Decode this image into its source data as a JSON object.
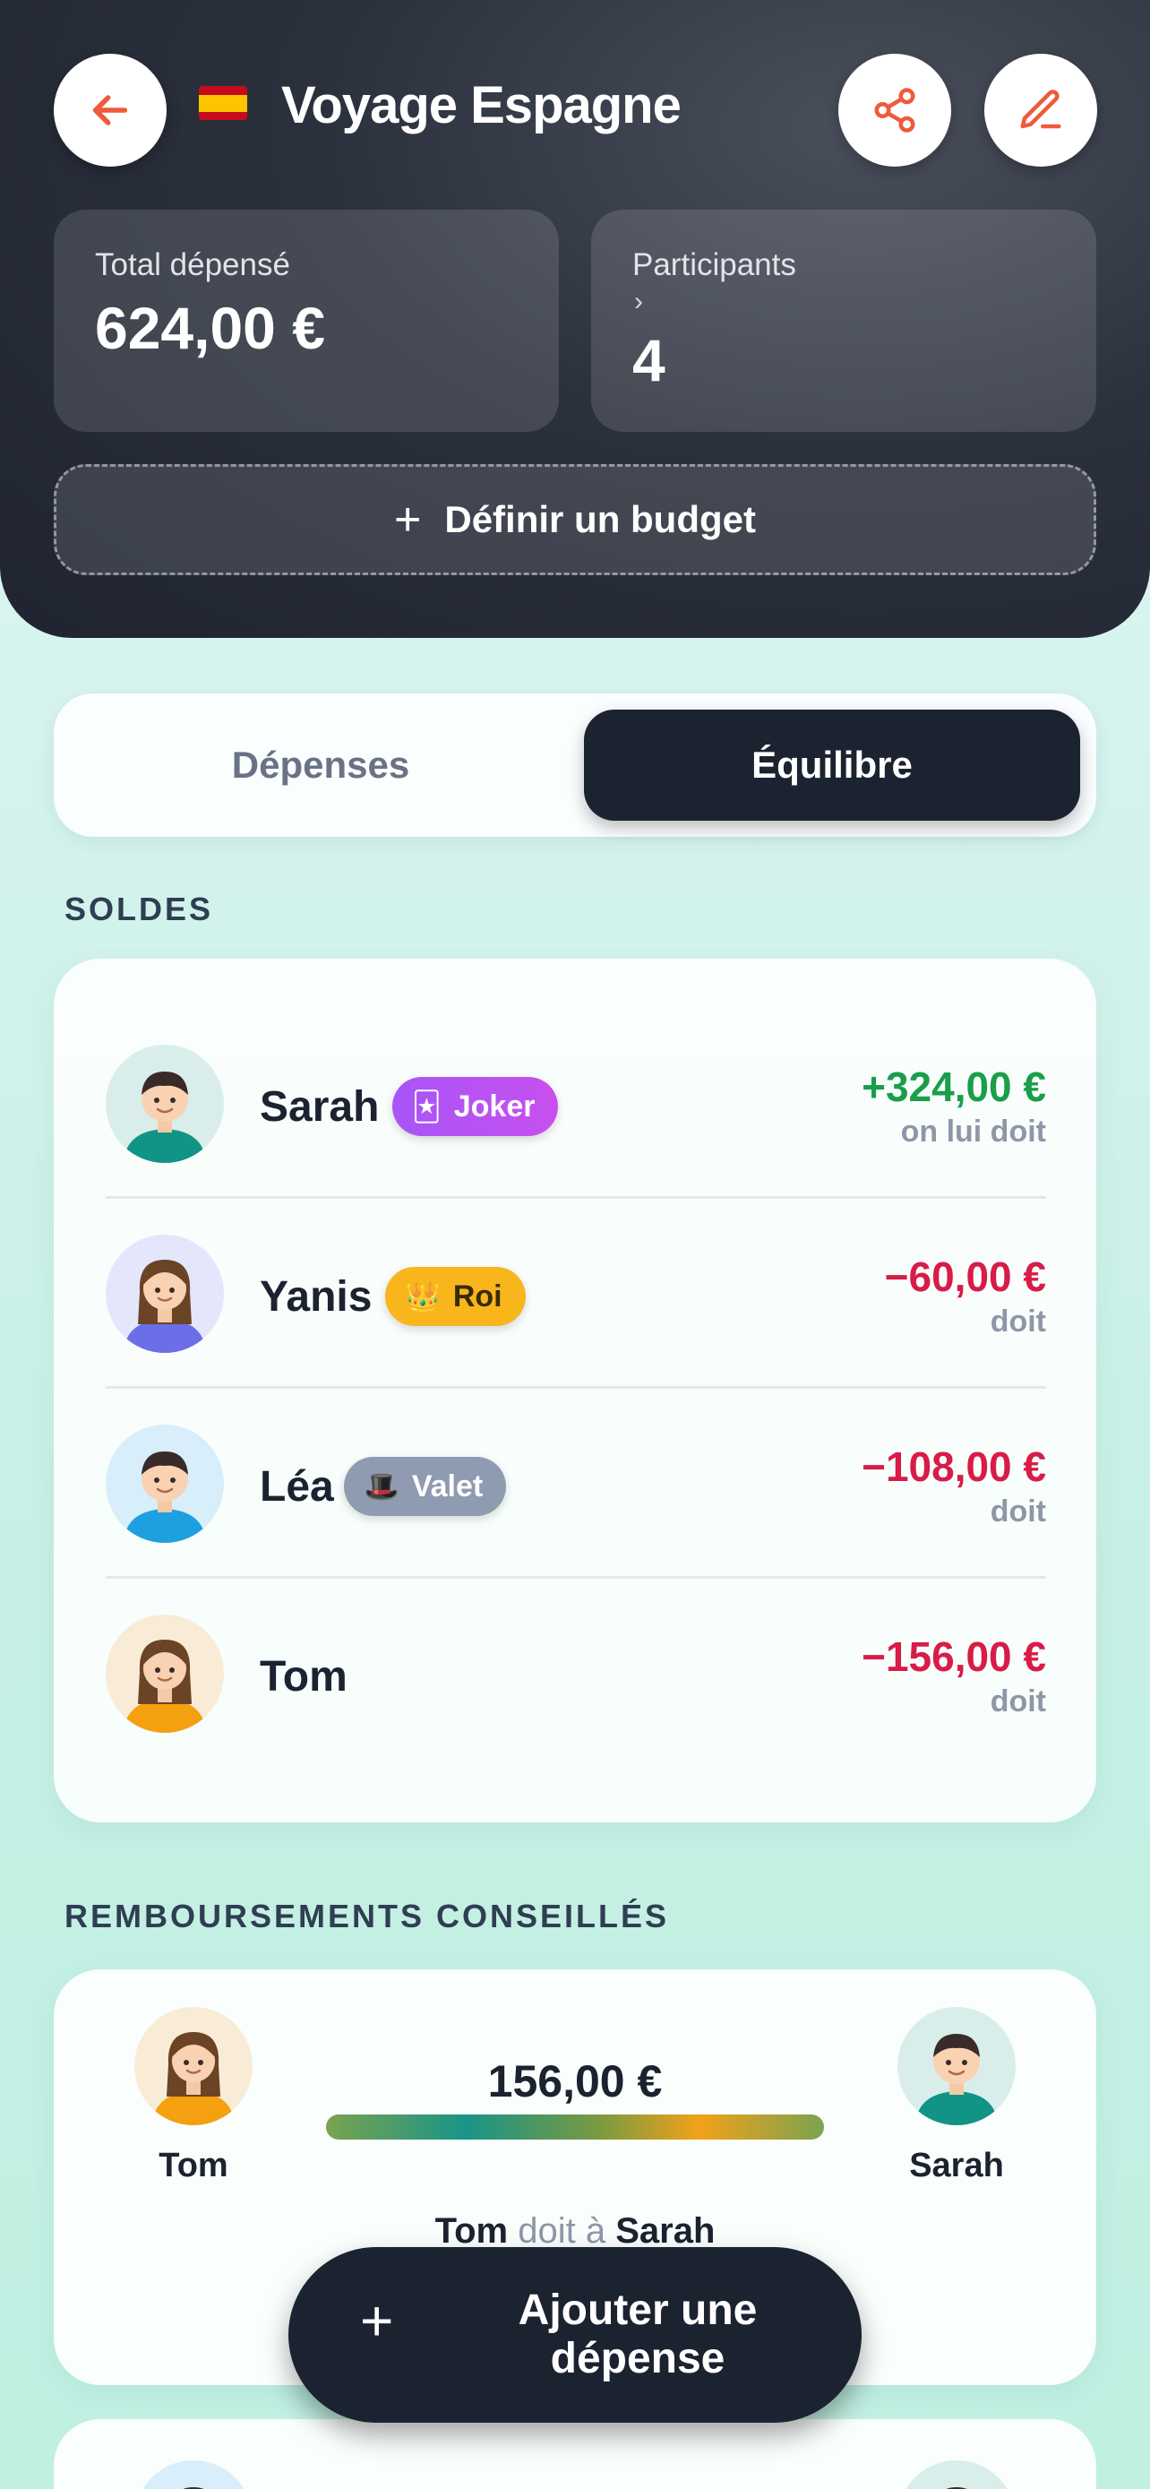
{
  "header": {
    "title": "Voyage Espagne",
    "flag": "spain-flag",
    "total_label": "Total dépensé",
    "total_value": "624,00 €",
    "participants_label": "Participants",
    "participants_chevron": "›",
    "participants_value": "4",
    "budget_label": "Définir un budget",
    "budget_plus": "+"
  },
  "icons": {
    "back": "arrow-left-icon",
    "share": "share-icon",
    "edit": "pencil-icon",
    "accent": "#ef5a3c"
  },
  "tabs": {
    "expenses": "Dépenses",
    "balance": "Équilibre",
    "active": "balance"
  },
  "balances": {
    "section_title": "SOLDES",
    "rows": [
      {
        "name": "Sarah",
        "badge": "Joker",
        "badge_icon": "🃏",
        "amount": "+324,00 €",
        "status": "on lui doit",
        "sign": "pos"
      },
      {
        "name": "Yanis",
        "badge": "Roi",
        "badge_icon": "👑",
        "amount": "−60,00 €",
        "status": "doit",
        "sign": "neg"
      },
      {
        "name": "Léa",
        "badge": "Valet",
        "badge_icon": "🎩",
        "amount": "−108,00 €",
        "status": "doit",
        "sign": "neg"
      },
      {
        "name": "Tom",
        "badge": "",
        "badge_icon": "",
        "amount": "−156,00 €",
        "status": "doit",
        "sign": "neg"
      }
    ]
  },
  "reimbursements": {
    "section_title": "REMBOURSEMENTS CONSEILLÉS",
    "items": [
      {
        "from": "Tom",
        "to": "Sarah",
        "amount": "156,00 €",
        "verb": "doit à"
      }
    ]
  },
  "fab": {
    "plus": "+",
    "label": "Ajouter une dépense"
  },
  "colors": {
    "positive": "#1a9e4a",
    "negative": "#d81c47",
    "dark": "#1b2230"
  }
}
